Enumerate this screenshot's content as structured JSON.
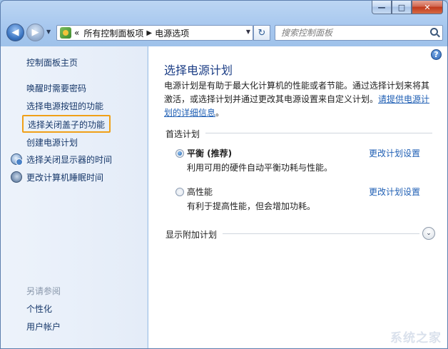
{
  "window": {
    "caption": {
      "minimize": "—",
      "maximize": "□",
      "close": "✕"
    }
  },
  "nav": {
    "back": "◀",
    "forward": "▶",
    "history": "▼",
    "address_prefix": "«",
    "breadcrumb": [
      "所有控制面板项",
      "电源选项"
    ],
    "breadcrumb_sep": "▶",
    "address_dropdown": "▼",
    "refresh": "↻",
    "search_placeholder": "搜索控制面板"
  },
  "sidebar": {
    "home": "控制面板主页",
    "items": [
      {
        "label": "唤醒时需要密码",
        "icon": ""
      },
      {
        "label": "选择电源按钮的功能",
        "icon": ""
      },
      {
        "label": "选择关闭盖子的功能",
        "icon": ""
      },
      {
        "label": "创建电源计划",
        "icon": ""
      },
      {
        "label": "选择关闭显示器的时间",
        "icon": "monitor-icon"
      },
      {
        "label": "更改计算机睡眠时间",
        "icon": "moon-icon"
      }
    ],
    "see_also_title": "另请参阅",
    "see_also": [
      "个性化",
      "用户帐户"
    ]
  },
  "content": {
    "help": "?",
    "title": "选择电源计划",
    "desc_text": "电源计划是有助于最大化计算机的性能或者节能。通过选择计划来将其激活，或选择计划并通过更改其电源设置来自定义计划。",
    "desc_link": "请提供电源计划的详细信息",
    "desc_end": "。",
    "preferred_header": "首选计划",
    "plans": [
      {
        "name": "平衡 (推荐)",
        "desc": "利用可用的硬件自动平衡功耗与性能。",
        "selected": true,
        "change": "更改计划设置"
      },
      {
        "name": "高性能",
        "desc": "有利于提高性能，但会增加功耗。",
        "selected": false,
        "change": "更改计划设置"
      }
    ],
    "additional_header": "显示附加计划",
    "expand": "⌄"
  },
  "watermark": "系统之家"
}
